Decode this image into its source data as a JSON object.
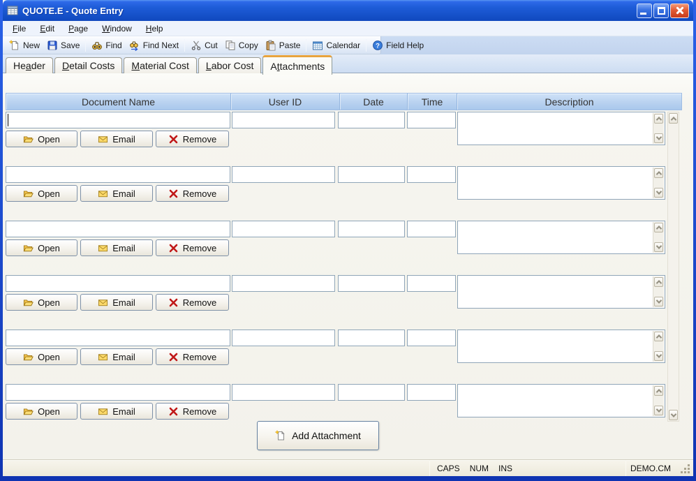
{
  "window": {
    "title": "QUOTE.E - Quote Entry"
  },
  "menu": {
    "items": [
      {
        "mnemonic": "F",
        "rest": "ile"
      },
      {
        "mnemonic": "E",
        "rest": "dit"
      },
      {
        "mnemonic": "P",
        "rest": "age"
      },
      {
        "mnemonic": "W",
        "rest": "indow"
      },
      {
        "mnemonic": "H",
        "rest": "elp"
      }
    ]
  },
  "toolbar": {
    "buttons": [
      {
        "label": "New"
      },
      {
        "label": "Save"
      },
      {
        "label": "Find"
      },
      {
        "label": "Find Next"
      },
      {
        "label": "Cut"
      },
      {
        "label": "Copy"
      },
      {
        "label": "Paste"
      },
      {
        "label": "Calendar"
      },
      {
        "label": "Field Help"
      }
    ]
  },
  "tabs": [
    {
      "pre": "He",
      "mnemonic": "a",
      "post": "der"
    },
    {
      "pre": "",
      "mnemonic": "D",
      "post": "etail Costs"
    },
    {
      "pre": "",
      "mnemonic": "M",
      "post": "aterial Cost"
    },
    {
      "pre": "",
      "mnemonic": "L",
      "post": "abor Cost"
    },
    {
      "pre": "A",
      "mnemonic": "t",
      "post": "tachments"
    }
  ],
  "active_tab": "Attachments",
  "attachments": {
    "columns": [
      "Document Name",
      "User ID",
      "Date",
      "Time",
      "Description"
    ],
    "row_count": 6,
    "fields": {
      "document_name": "",
      "user_id": "",
      "date": "",
      "time": "",
      "description": ""
    },
    "buttons": {
      "open": "Open",
      "email": "Email",
      "remove": "Remove"
    },
    "add_button": "Add Attachment"
  },
  "status_bar": {
    "caps": "CAPS",
    "num": "NUM",
    "ins": "INS",
    "environment": "DEMO.CM"
  },
  "colors": {
    "titlebar_blue": "#1E5CD8",
    "window_border_blue": "#2257E0",
    "header_blue": "#B9D2F0",
    "active_tab_accent": "#E8A33D",
    "remove_red": "#C01818",
    "folder_gold": "#F6C64E"
  }
}
